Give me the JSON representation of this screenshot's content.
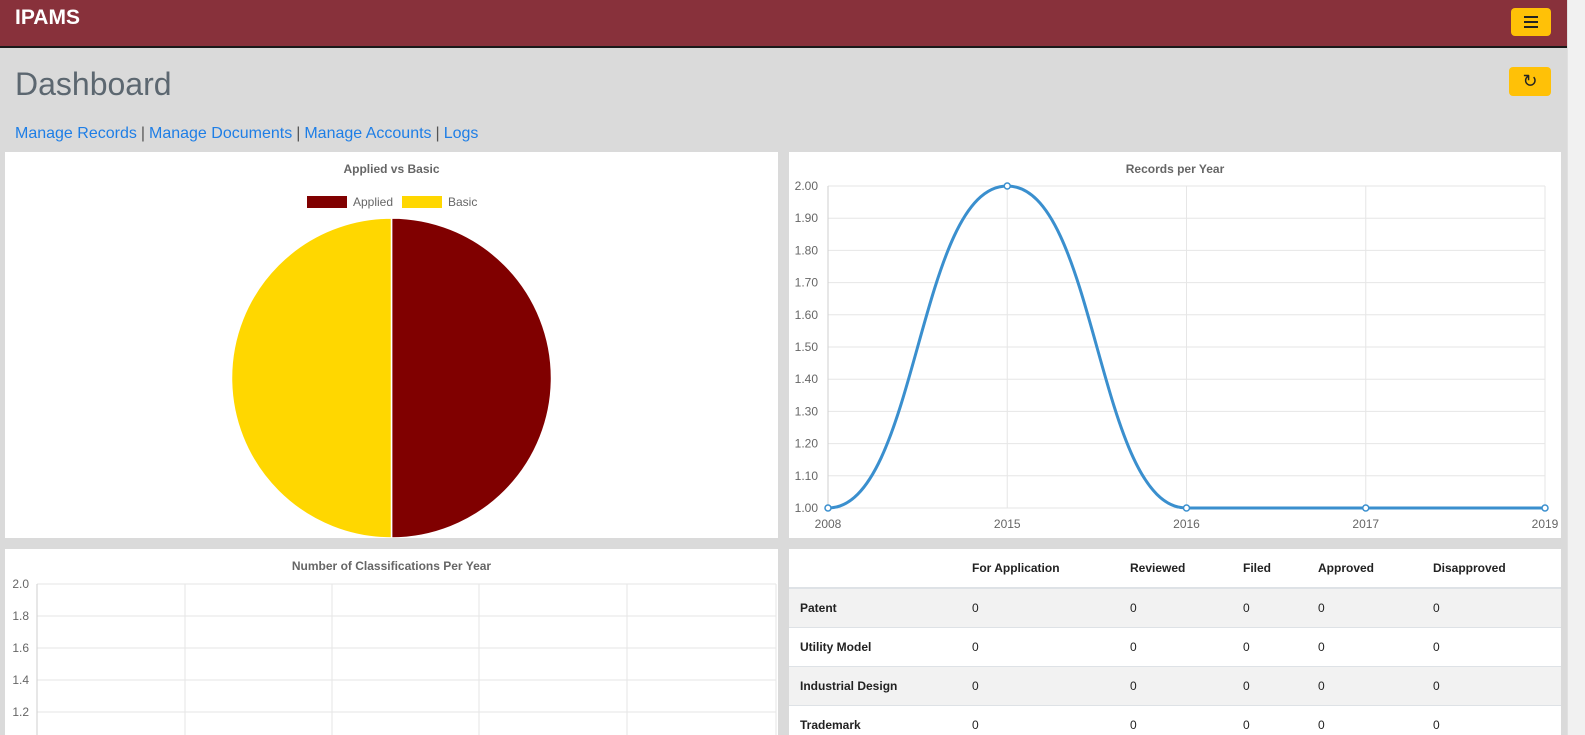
{
  "app": {
    "brand": "IPAMS"
  },
  "page": {
    "title": "Dashboard"
  },
  "nav": {
    "links": [
      "Manage Records",
      "Manage Documents",
      "Manage Accounts",
      "Logs"
    ],
    "separator": "|"
  },
  "icons": {
    "menu": "hamburger-icon",
    "refresh": "refresh-icon"
  },
  "colors": {
    "header": "#88313b",
    "accent": "#ffc107",
    "link": "#1e7ee6",
    "applied": "#800000",
    "basic": "#ffd700",
    "line": "#3a8fce"
  },
  "chart_data": [
    {
      "type": "pie",
      "title": "Applied vs Basic",
      "legend": "top",
      "labels": [
        "Applied",
        "Basic"
      ],
      "values": [
        1,
        1
      ],
      "colors": [
        "#800000",
        "#ffd700"
      ]
    },
    {
      "type": "line",
      "title": "Records per Year",
      "categories": [
        "2008",
        "2015",
        "2016",
        "2017",
        "2019"
      ],
      "series": [
        {
          "values": [
            1.0,
            2.0,
            1.0,
            1.0,
            1.0
          ],
          "color": "#3a8fce"
        }
      ],
      "ylim": [
        1.0,
        2.0
      ],
      "yticks": [
        "2.00",
        "1.90",
        "1.80",
        "1.70",
        "1.60",
        "1.50",
        "1.40",
        "1.30",
        "1.20",
        "1.10",
        "1.00"
      ],
      "grid": true
    },
    {
      "type": "line",
      "title": "Number of Classifications Per Year",
      "categories": [],
      "series": [],
      "yticks": [
        "2.0",
        "1.8",
        "1.6",
        "1.4",
        "1.2"
      ],
      "grid": true
    },
    {
      "type": "table",
      "columns": [
        "",
        "For Application",
        "Reviewed",
        "Filed",
        "Approved",
        "Disapproved"
      ],
      "rows": [
        {
          "label": "Patent",
          "values": [
            "0",
            "0",
            "0",
            "0",
            "0"
          ]
        },
        {
          "label": "Utility Model",
          "values": [
            "0",
            "0",
            "0",
            "0",
            "0"
          ]
        },
        {
          "label": "Industrial Design",
          "values": [
            "0",
            "0",
            "0",
            "0",
            "0"
          ]
        },
        {
          "label": "Trademark",
          "values": [
            "0",
            "0",
            "0",
            "0",
            "0"
          ]
        }
      ]
    }
  ]
}
